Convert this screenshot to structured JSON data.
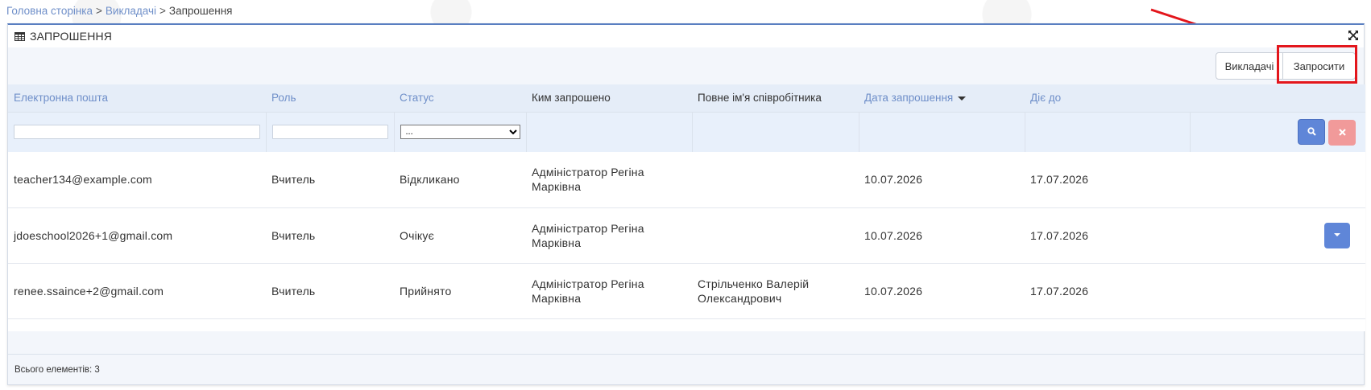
{
  "breadcrumb": {
    "home": "Головна сторінка",
    "separator": ">",
    "teachers": "Викладачі",
    "current": "Запрошення"
  },
  "panel": {
    "title": "ЗАПРОШЕННЯ"
  },
  "toolbar": {
    "teachers_label": "Викладачі",
    "invite_label": "Запросити"
  },
  "columns": {
    "email": "Електронна пошта",
    "role": "Роль",
    "status": "Статус",
    "invited_by": "Ким запрошено",
    "employee_name": "Повне ім'я співробітника",
    "invite_date": "Дата запрошення",
    "valid_until": "Діє до"
  },
  "filters": {
    "status_selected": "..."
  },
  "rows": [
    {
      "email": "teacher134@example.com",
      "role": "Вчитель",
      "status": "Відкликано",
      "invited_by": "Адміністратор Регіна Марківна",
      "employee_name": "",
      "invite_date": "10.07.2026",
      "valid_until": "17.07.2026"
    },
    {
      "email": "jdoeschool2026+1@gmail.com",
      "role": "Вчитель",
      "status": "Очікує",
      "invited_by": "Адміністратор Регіна Марківна",
      "employee_name": "",
      "invite_date": "10.07.2026",
      "valid_until": "17.07.2026"
    },
    {
      "email": "renee.ssaince+2@gmail.com",
      "role": "Вчитель",
      "status": "Прийнято",
      "invited_by": "Адміністратор Регіна Марківна",
      "employee_name": "Стрільченко Валерій Олександрович",
      "invite_date": "10.07.2026",
      "valid_until": "17.07.2026"
    }
  ],
  "footer": {
    "total": "Всього елементів: 3"
  },
  "colors": {
    "accent": "#5f86d8",
    "link": "#6f8fc9",
    "annotation": "#e3161c",
    "clear": "#f19a9a"
  }
}
